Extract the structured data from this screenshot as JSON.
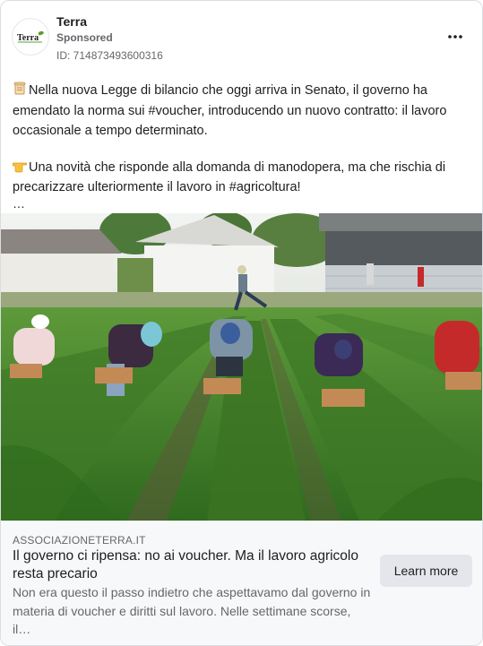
{
  "post": {
    "page_name": "Terra",
    "sponsored_label": "Sponsored",
    "ad_id": "ID: 714873493600316",
    "logo_text": "Terra",
    "more_icon": "more-horizontal-icon",
    "body": {
      "paragraph_1": "Nella nuova Legge di bilancio che oggi arriva in Senato, il governo ha emendato la norma sui #voucher, introducendo un nuovo contratto: il lavoro occasionale a tempo determinato.",
      "paragraph_1_icon": "scroll-icon",
      "paragraph_2": "Una novità che risponde alla domanda di manodopera, ma che rischia di precarizzare ulteriormente il lavoro in #agricoltura!",
      "paragraph_2_icon": "pointing-hand-icon",
      "truncation": "…"
    },
    "image": {
      "subject": "farm workers picking crops in a field"
    },
    "link": {
      "domain": "ASSOCIAZIONETERRA.IT",
      "headline": "Il governo ci ripensa: no ai voucher. Ma il lavoro agricolo resta precario",
      "description": "Non era questo il passo indietro che aspettavamo dal governo in materia di voucher e diritti sul lavoro. Nelle settimane scorse, il…",
      "cta_label": "Learn more"
    }
  },
  "colors": {
    "text_primary": "#1c1e21",
    "text_secondary": "#65676b",
    "button_bg": "#e4e6eb",
    "link_area_bg": "#f7f8fa",
    "logo_green": "#5aa02c"
  }
}
